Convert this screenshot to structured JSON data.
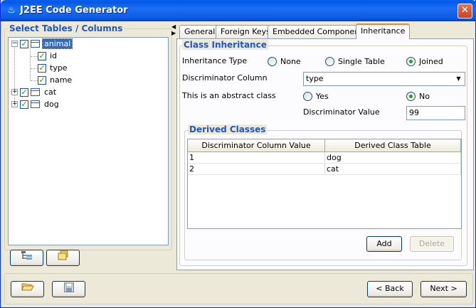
{
  "window": {
    "title": "J2EE Code Generator",
    "icon": "java-cup-icon",
    "close_glyph": "✕"
  },
  "left_panel": {
    "group_title": "Select Tables / Columns",
    "tree": [
      {
        "label": "animal",
        "checked": true,
        "expanded": true,
        "selected": true,
        "children": [
          {
            "label": "id",
            "checked": true
          },
          {
            "label": "type",
            "checked": true
          },
          {
            "label": "name",
            "checked": true
          }
        ]
      },
      {
        "label": "cat",
        "checked": true,
        "expanded": false
      },
      {
        "label": "dog",
        "checked": true,
        "expanded": false
      }
    ],
    "toolbar": {
      "hierarchy_icon": "tree-view-icon",
      "folder_icon": "folder-icon"
    }
  },
  "tabs": [
    "General",
    "Foreign Keys",
    "Embedded Components",
    "Inheritance"
  ],
  "active_tab": "Inheritance",
  "inheritance": {
    "section_title": "Class Inheritance",
    "inheritance_type_label": "Inheritance Type",
    "options": [
      "None",
      "Single Table",
      "Joined"
    ],
    "selected_option": "Joined",
    "discriminator_column_label": "Discriminator Column",
    "discriminator_column_value": "type",
    "abstract_label": "This is an abstract class",
    "abstract_yes": "Yes",
    "abstract_no": "No",
    "abstract_selected": "No",
    "discriminator_value_label": "Discriminator Value",
    "discriminator_value": "99"
  },
  "derived": {
    "section_title": "Derived Classes",
    "columns": [
      "Discriminator Column Value",
      "Derived Class Table"
    ],
    "rows": [
      [
        "1",
        "dog"
      ],
      [
        "2",
        "cat"
      ]
    ],
    "add_label": "Add",
    "delete_label": "Delete"
  },
  "bottom": {
    "open_icon": "open-folder-icon",
    "save_icon": "save-disk-icon",
    "back_label": "< Back",
    "next_label": "Next >"
  },
  "colors": {
    "accent": "#1F57C6",
    "titlebar": "#0A5CE5",
    "selection": "#316AC5",
    "check": "#21A121",
    "tab_highlight": "#E68B2C"
  }
}
